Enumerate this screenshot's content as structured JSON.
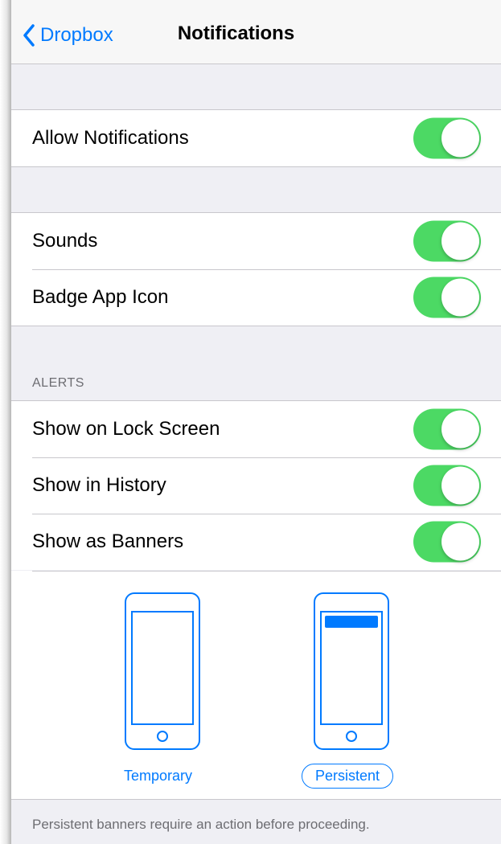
{
  "nav": {
    "back_label": "Dropbox",
    "title": "Notifications"
  },
  "groups": {
    "allow": {
      "label": "Allow Notifications",
      "on": true
    },
    "sounds": {
      "label": "Sounds",
      "on": true
    },
    "badge": {
      "label": "Badge App Icon",
      "on": true
    }
  },
  "alerts": {
    "header": "ALERTS",
    "lock_screen": {
      "label": "Show on Lock Screen",
      "on": true
    },
    "history": {
      "label": "Show in History",
      "on": true
    },
    "banners": {
      "label": "Show as Banners",
      "on": true
    }
  },
  "banner_style": {
    "temporary_label": "Temporary",
    "persistent_label": "Persistent",
    "selected": "Persistent"
  },
  "footer": "Persistent banners require an action before proceeding.",
  "colors": {
    "accent": "#007aff",
    "toggle_on": "#4cd964",
    "background": "#efeff4"
  }
}
